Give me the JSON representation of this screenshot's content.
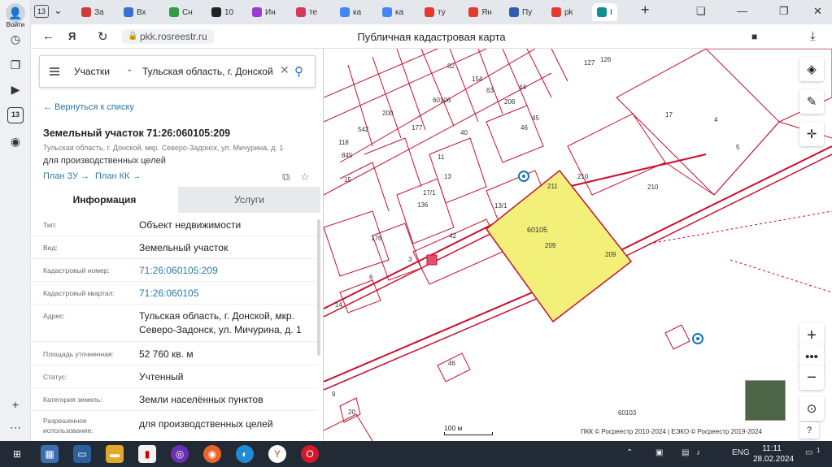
{
  "browser": {
    "login_label": "Войти",
    "tab_count": "13",
    "rail_badge": "13",
    "tabs": [
      {
        "label": "За",
        "color": "#d23a3a"
      },
      {
        "label": "Вх",
        "color": "#3a6fd2"
      },
      {
        "label": "Сн",
        "color": "#2f9e44"
      },
      {
        "label": "10",
        "color": "#222222"
      },
      {
        "label": "Ин",
        "color": "#9b3ad2"
      },
      {
        "label": "те",
        "color": "#d23a5a"
      },
      {
        "label": "ка",
        "color": "#4285f4"
      },
      {
        "label": "ка",
        "color": "#4285f4"
      },
      {
        "label": "ту",
        "color": "#e23b2e"
      },
      {
        "label": "Ян",
        "color": "#e23b2e"
      },
      {
        "label": "Пу",
        "color": "#2d5fb0"
      },
      {
        "label": "pk",
        "color": "#e23b2e"
      },
      {
        "label": "I",
        "color": "#0f8f8f"
      }
    ],
    "url": "pkk.rosreestr.ru",
    "page_title": "Публичная кадастровая карта"
  },
  "search": {
    "type_label": "Участки",
    "query": "Тульская область, г. Донской,"
  },
  "panel": {
    "back_label": "← Вернуться к списку",
    "title": "Земельный участок 71:26:060105:209",
    "address_small": "Тульская область, г. Донской, мкр. Северо-Задонск, ул. Мичурина, д. 1",
    "purpose": "для производственных целей",
    "plan_zu": "План ЗУ →",
    "plan_kk": "План КК →",
    "tab_info": "Информация",
    "tab_services": "Услуги",
    "rows": [
      {
        "label": "Тип:",
        "value": "Объект недвижимости",
        "link": false
      },
      {
        "label": "Вид:",
        "value": "Земельный участок",
        "link": false
      },
      {
        "label": "Кадастровый номер:",
        "value": "71:26:060105:209",
        "link": true
      },
      {
        "label": "Кадастровый квартал:",
        "value": "71:26:060105",
        "link": true
      },
      {
        "label": "Адрес:",
        "value": "Тульская область, г. Донской, мкр. Северо-Задонск, ул. Мичурина, д. 1",
        "link": false
      },
      {
        "label": "Площадь уточненная:",
        "value": "52 760 кв. м",
        "link": false
      },
      {
        "label": "Статус:",
        "value": "Учтенный",
        "link": false
      },
      {
        "label": "Категория земель:",
        "value": "Земли населённых пунктов",
        "link": false
      },
      {
        "label": "Разрешенное использование:",
        "value": "для производственных целей",
        "link": false
      }
    ]
  },
  "map": {
    "highlight_color": "#f3f07a",
    "boundary_color": "#c8102e",
    "labels": [
      "60106",
      "60105",
      "209",
      "210",
      "210",
      "211",
      "13/1",
      "42",
      "176",
      "136",
      "60103",
      "17",
      "4",
      "5",
      "3",
      "6",
      "14",
      "9",
      "20",
      "46",
      "11",
      "13",
      "15",
      "177",
      "206",
      "200",
      "44",
      "45",
      "46",
      "154",
      "63",
      "82",
      "40",
      "542",
      "118",
      "845",
      "127",
      "126",
      "17/1",
      "209"
    ],
    "scale_label": "100 м",
    "copyright": "ПКК © Росреестр 2010-2024 | ЕЭКО © Росреестр 2019-2024"
  },
  "taskbar": {
    "lang": "ENG",
    "time": "11:11",
    "date": "28.02.2024",
    "notif_count": "1"
  }
}
